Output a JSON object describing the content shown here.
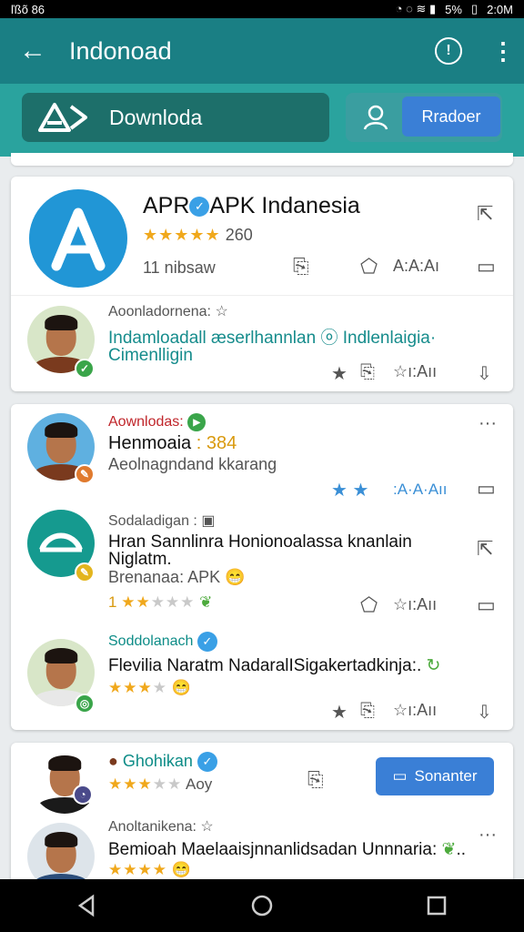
{
  "status_bar": {
    "left": "ľßõ 86",
    "battery": "5%",
    "time": "2:0M"
  },
  "app_bar": {
    "title": "Indonoad"
  },
  "search": {
    "label": "Downloda",
    "button": "Rradoer"
  },
  "card1": {
    "app_name_a": "APR",
    "app_name_b": "APK Indanesia",
    "rating_count": "260",
    "downloads": "11 nibsaw",
    "action_text": "A:A:Aı",
    "comment": {
      "header": "Aoonladornena:",
      "body_a": "Indamloadall æserlhannlan",
      "body_b": "Indlenlaigia·",
      "body_c": "Cimenlligin",
      "footer_text": "ı:Aıı"
    }
  },
  "card2": {
    "posts": [
      {
        "category": "Aownlodas:",
        "title_a": "Henmoaia",
        "title_b": ": 384",
        "subtitle": "Aeolnagndand kkarang",
        "footer_text": ":A·A·Aıı"
      },
      {
        "category": "Sodaladigan :",
        "title": "Hran Sannlinra Honionoalassa knanlain Niglatm.",
        "subtitle": "Brenanaa: APK",
        "rating_num": "1",
        "footer_text": "ı:Aıı"
      },
      {
        "category": "Soddolanach",
        "title": "Flevilia Naratm NadaralISigakertadkinja:.",
        "footer_text": "ı:Aıı"
      }
    ]
  },
  "card3": {
    "name": "Ghohikan",
    "rating_text": "Aoy",
    "button": "Sonanter",
    "comment_header": "Anoltanikena:",
    "comment_body": "Bemioah Maelaaisjnnanlidsadan Unnnaria:"
  },
  "colors": {
    "appbar": "#1a7f84",
    "accent_teal": "#2aa39e",
    "link_teal": "#168c8c",
    "button_blue": "#3a7fd6",
    "star": "#f0a81c",
    "category_red": "#c0262b",
    "category_teal": "#0d8c87"
  },
  "icons": [
    "arrow-left-icon",
    "info-icon",
    "more-vert-icon",
    "logo-icon",
    "user-icon",
    "share-icon",
    "bookmark-icon",
    "comment-icon",
    "star-icon",
    "back-nav-icon",
    "home-nav-icon",
    "recents-nav-icon"
  ]
}
